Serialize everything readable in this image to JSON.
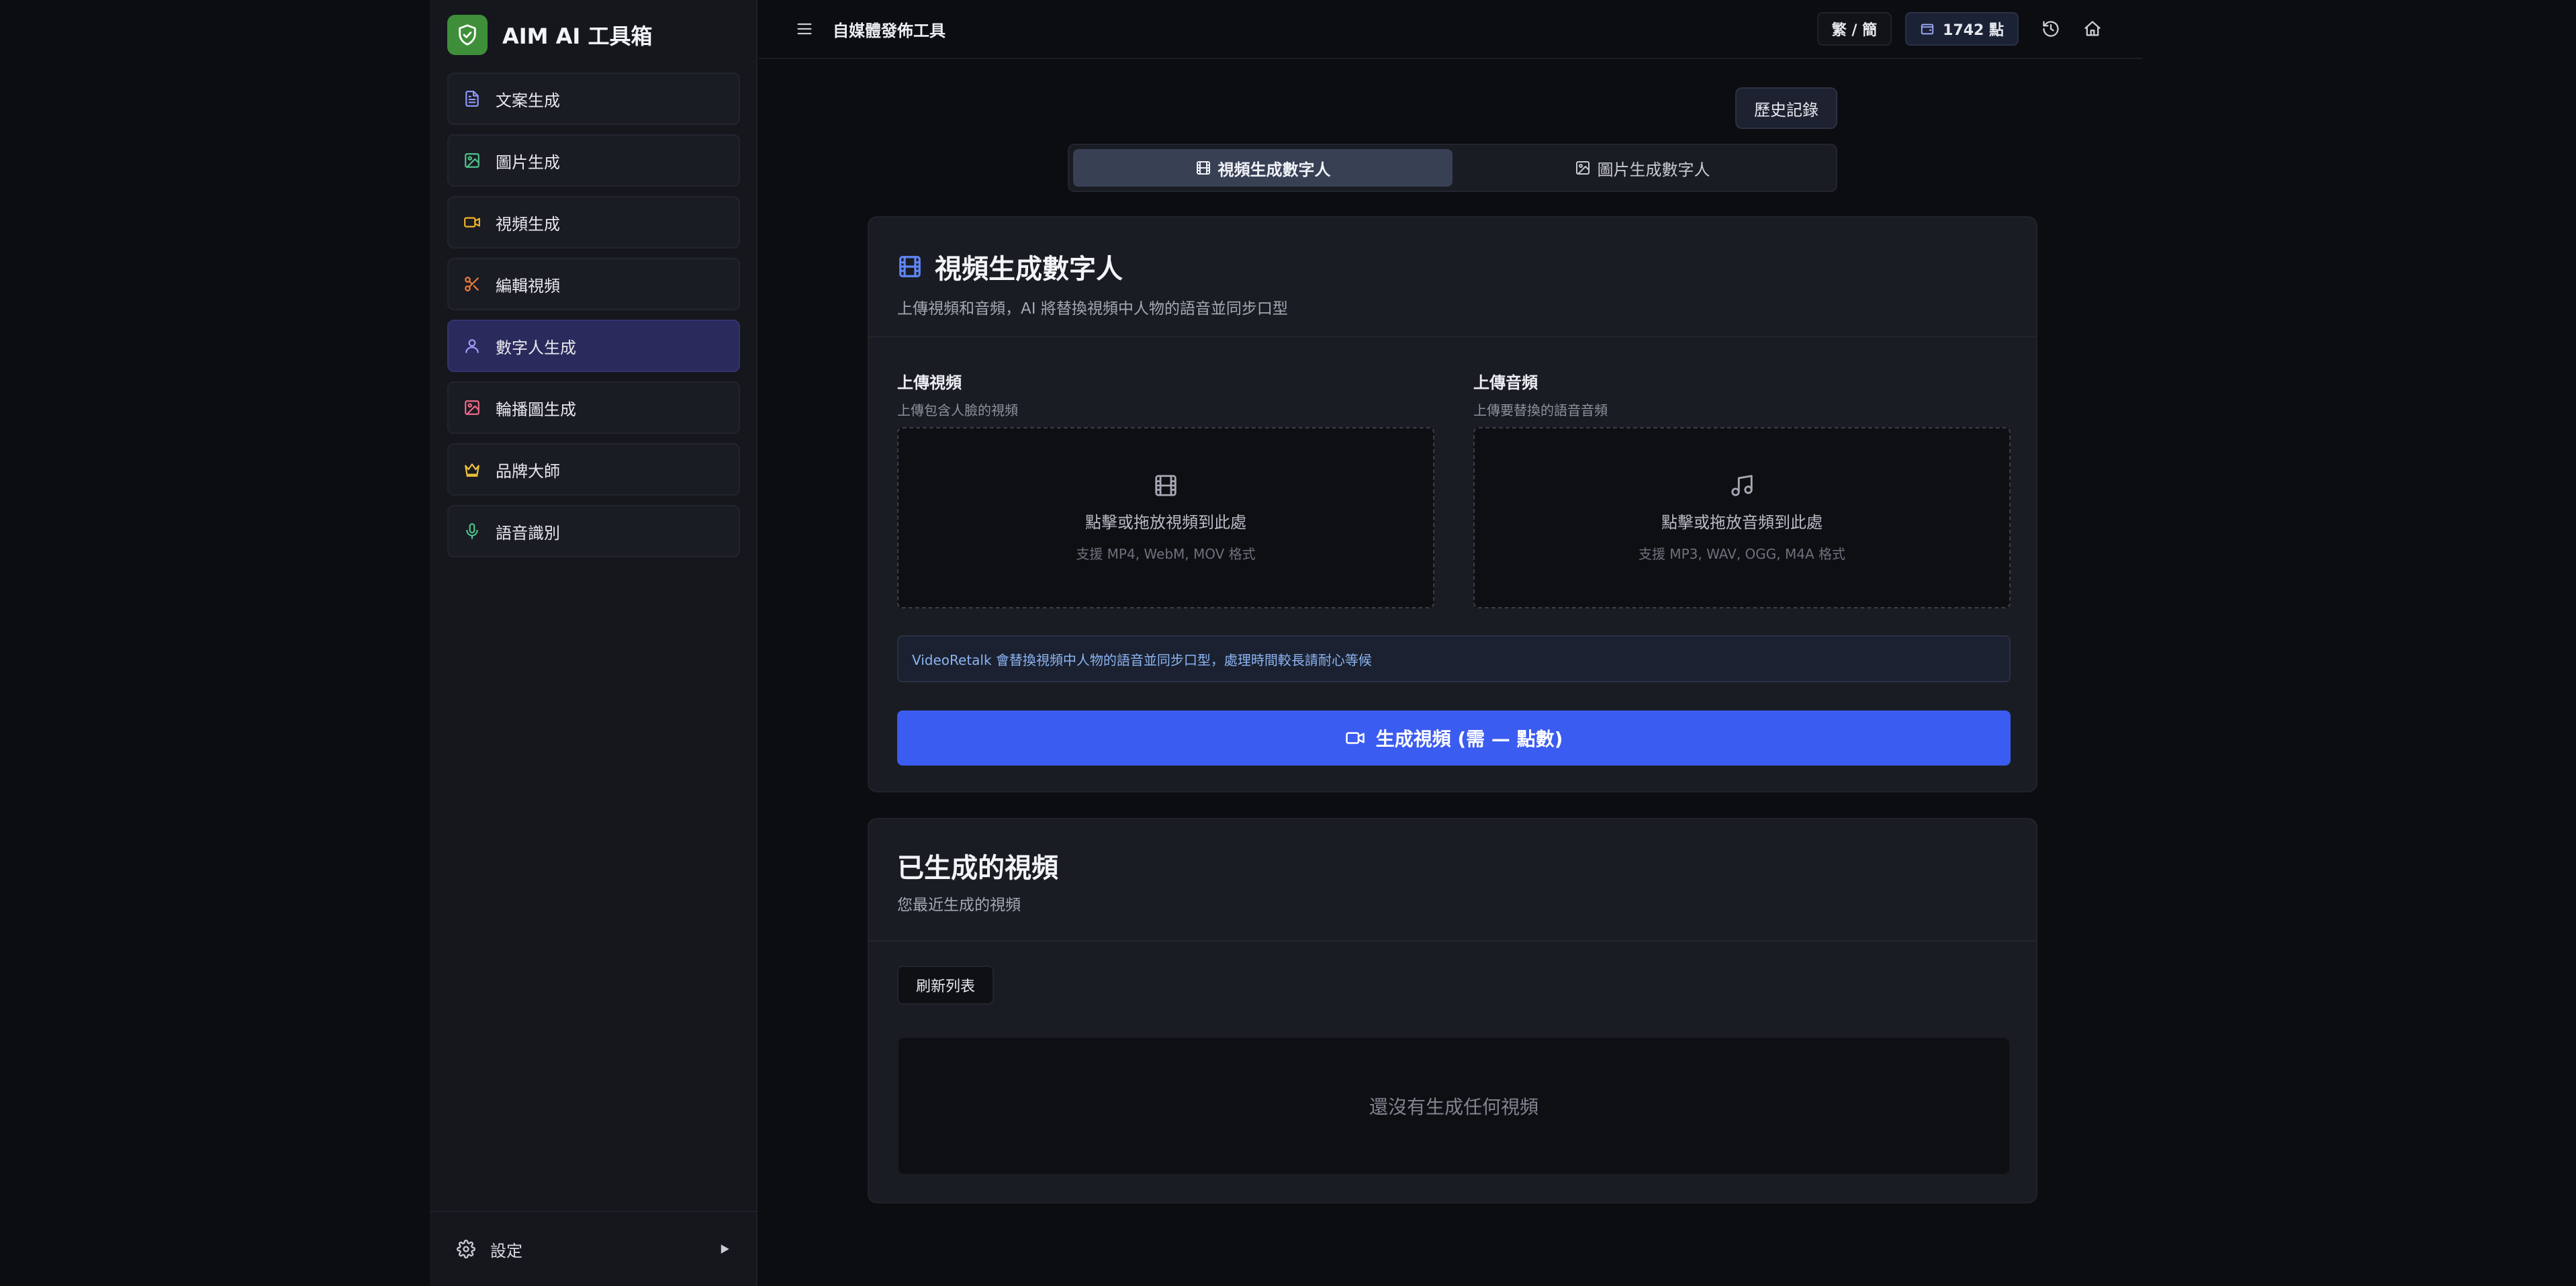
{
  "app": {
    "title": "AIM AI 工具箱"
  },
  "sidebar": {
    "items": [
      {
        "label": "文案生成",
        "icon": "document-icon",
        "color": "#8f9bff"
      },
      {
        "label": "圖片生成",
        "icon": "image-icon",
        "color": "#4fc38a"
      },
      {
        "label": "視頻生成",
        "icon": "video-icon",
        "color": "#f0b429"
      },
      {
        "label": "編輯視頻",
        "icon": "scissors-icon",
        "color": "#f07c3c"
      },
      {
        "label": "數字人生成",
        "icon": "user-icon",
        "color": "#a79bff",
        "active": true
      },
      {
        "label": "輪播圖生成",
        "icon": "image-icon",
        "color": "#f06a8a"
      },
      {
        "label": "品牌大師",
        "icon": "crown-icon",
        "color": "#f0c43c"
      },
      {
        "label": "語音識別",
        "icon": "microphone-icon",
        "color": "#4fc38a"
      }
    ],
    "footer_label": "設定"
  },
  "topbar": {
    "title": "自媒體發佈工具",
    "lang_toggle": "繁 / 簡",
    "points": "1742 點"
  },
  "main": {
    "history_button": "歷史記錄",
    "tabs": [
      {
        "label": "視頻生成數字人",
        "active": true
      },
      {
        "label": "圖片生成數字人",
        "active": false
      }
    ],
    "section": {
      "title": "視頻生成數字人",
      "subtitle": "上傳視頻和音頻，AI 將替換視頻中人物的語音並同步口型"
    },
    "upload_video": {
      "label": "上傳視頻",
      "hint": "上傳包含人臉的視頻",
      "drop_text": "點擊或拖放視頻到此處",
      "formats": "支援 MP4, WebM, MOV 格式"
    },
    "upload_audio": {
      "label": "上傳音頻",
      "hint": "上傳要替換的語音音頻",
      "drop_text": "點擊或拖放音頻到此處",
      "formats": "支援 MP3, WAV, OGG, M4A 格式"
    },
    "info": "VideoRetalk 會替換視頻中人物的語音並同步口型，處理時間較長請耐心等候",
    "generate_button": "生成視頻 (需 — 點數)",
    "generated": {
      "title": "已生成的視頻",
      "subtitle": "您最近生成的視頻",
      "refresh_button": "刷新列表",
      "empty_text": "還沒有生成任何視頻"
    }
  },
  "colors": {
    "accent": "#3b5cf0",
    "brand": "#3f8f3a",
    "active_nav": "#2a2a5c"
  }
}
